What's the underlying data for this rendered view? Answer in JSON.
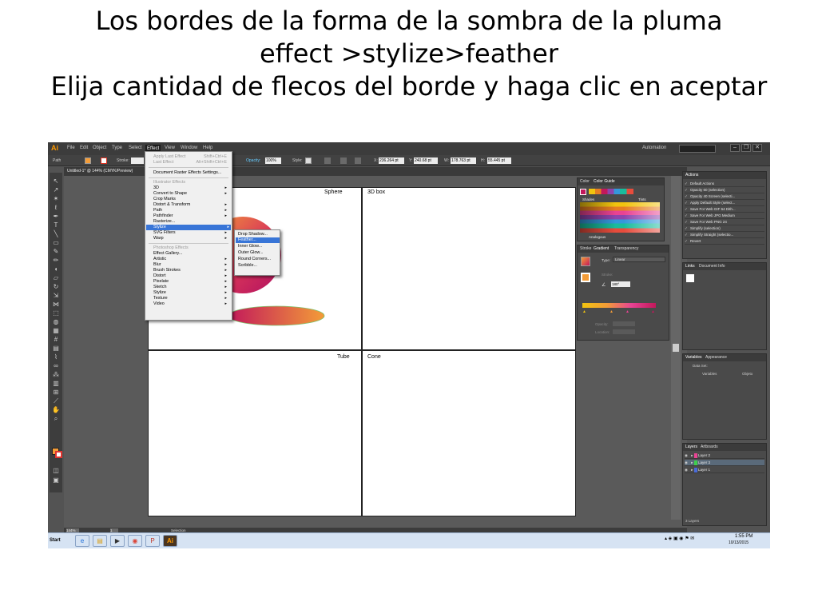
{
  "slide": {
    "title_line1": "Los bordes de la forma de la sombra de la pluma",
    "title_line2": "effect >stylize>feather",
    "title_line3": "Elija cantidad de flecos del borde y haga clic en aceptar"
  },
  "app": {
    "logo": "Ai",
    "menus": [
      "File",
      "Edit",
      "Object",
      "Type",
      "Select",
      "Effect",
      "View",
      "Window",
      "Help"
    ],
    "active_menu": "Effect",
    "workspace": "Automation",
    "document_tab": "Untitled-1* @ 144% (CMYK/Preview)"
  },
  "control_bar": {
    "path_label": "Path",
    "stroke_label": "Stroke:",
    "opacity_label": "Opacity:",
    "opacity_value": "100%",
    "style_label": "Style:",
    "x_value": "236.264 pt",
    "y_value": "240.68 pt",
    "w_value": "178.763 pt",
    "h_value": "55.445 pt"
  },
  "effect_menu": {
    "apply_last": "Apply Last Effect",
    "apply_last_sc": "Shift+Ctrl+E",
    "last_effect": "Last Effect",
    "last_effect_sc": "Alt+Shift+Ctrl+E",
    "document_raster": "Document Raster Effects Settings...",
    "illustrator_head": "Illustrator Effects",
    "illustrator_items": [
      "3D",
      "Convert to Shape",
      "Crop Marks",
      "Distort & Transform",
      "Path",
      "Pathfinder",
      "Rasterize...",
      "Stylize",
      "SVG Filters",
      "Warp"
    ],
    "photoshop_head": "Photoshop Effects",
    "photoshop_items": [
      "Effect Gallery...",
      "Artistic",
      "Blur",
      "Brush Strokes",
      "Distort",
      "Pixelate",
      "Sketch",
      "Stylize",
      "Texture",
      "Video"
    ]
  },
  "stylize_submenu": {
    "items": [
      "Drop Shadow...",
      "Feather...",
      "Inner Glow...",
      "Outer Glow...",
      "Round Corners...",
      "Scribble..."
    ],
    "highlighted": "Feather..."
  },
  "artboards": {
    "sphere": "Sphere",
    "box": "3D box",
    "tube": "Tube",
    "cone": "Cone"
  },
  "color_panel": {
    "tab_color": "Color",
    "tab_guide": "Color Guide",
    "shades": "Shades",
    "tints": "Tints",
    "analogous": "Analogous"
  },
  "gradient_panel": {
    "tab_stroke": "Stroke",
    "tab_gradient": "Gradient",
    "tab_transparency": "Transparency",
    "type_label": "Type:",
    "type_value": "Linear",
    "stroke_label": "Stroke:",
    "angle_value": "180°",
    "opacity_label": "Opacity:",
    "location_label": "Location:"
  },
  "actions_panel": {
    "title": "Actions",
    "items": [
      "Default Actions",
      "Opacity 60 (selection)",
      "Opacity 40 Screen (selecti...",
      "Apply Default Style (select...",
      "Save For Web GIF 64 Dith...",
      "Save For Web JPG Medium",
      "Save For Web PNG 24",
      "Simplify (selection)",
      "Simplify Straight (selectio...",
      "Revert"
    ]
  },
  "links_panel": {
    "tab_links": "Links",
    "tab_docinfo": "Document Info"
  },
  "variables_panel": {
    "tab_variables": "Variables",
    "tab_appearance": "Appearance",
    "data_set": "Data Set:",
    "col_variables": "Variables",
    "col_object": "Objeto"
  },
  "layers_panel": {
    "tab_layers": "Layers",
    "tab_artboards": "Artboards",
    "layers": [
      "Layer 2",
      "Layer 3",
      "Layer 1"
    ],
    "footer": "3 Layers"
  },
  "status_bar": {
    "zoom": "144%",
    "page": "1",
    "mode": "Selection"
  },
  "taskbar": {
    "start": "Start",
    "time": "1:55 PM",
    "date": "10/13/2015"
  },
  "colors": {
    "orange": "#f39c38",
    "magenta": "#c2185b",
    "highlight": "#3875d7"
  }
}
